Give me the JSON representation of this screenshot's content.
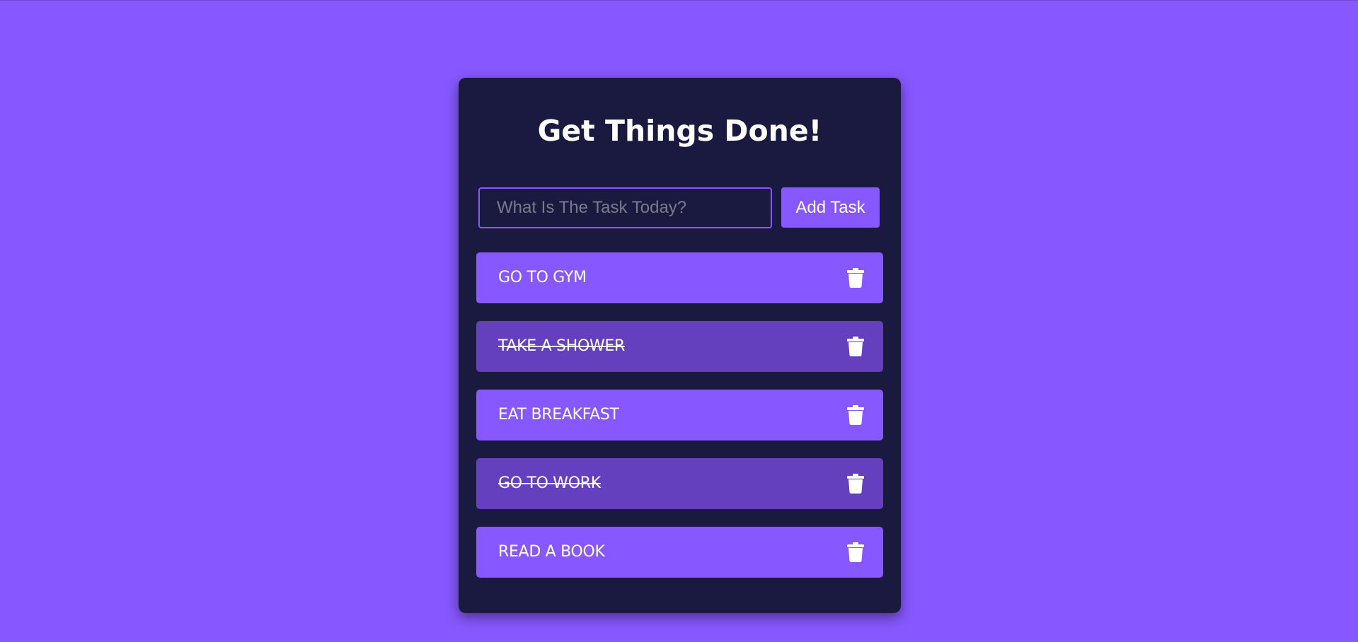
{
  "app": {
    "title": "Get Things Done!"
  },
  "form": {
    "placeholder": "What Is The Task Today?",
    "value": "",
    "add_label": "Add Task"
  },
  "tasks": [
    {
      "label": "GO TO GYM",
      "completed": false
    },
    {
      "label": "TAKE A SHOWER",
      "completed": true
    },
    {
      "label": "EAT BREAKFAST",
      "completed": false
    },
    {
      "label": "GO TO WORK",
      "completed": true
    },
    {
      "label": "READ A BOOK",
      "completed": false
    }
  ],
  "icons": {
    "delete": "trash-icon"
  },
  "colors": {
    "background": "#8758ff",
    "card": "#1a1a40",
    "task": "#8758ff",
    "task_completed": "#6440bf",
    "text": "#ffffff"
  }
}
